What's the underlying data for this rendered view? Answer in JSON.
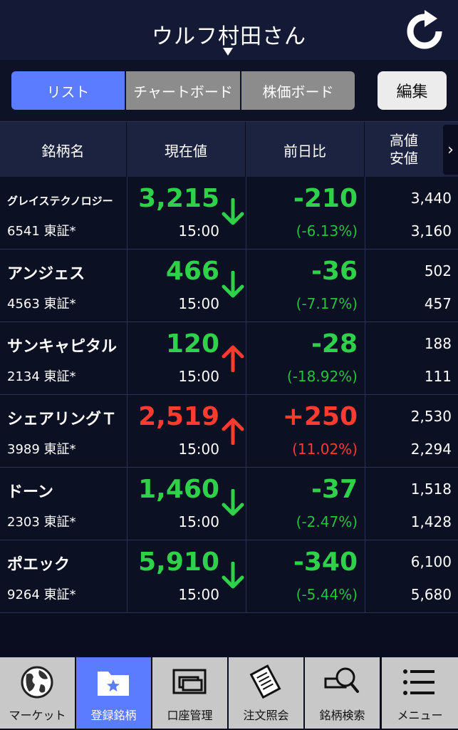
{
  "header": {
    "title": "ウルフ村田さん"
  },
  "segments": [
    {
      "label": "リスト",
      "active": true
    },
    {
      "label": "チャートボード",
      "active": false
    },
    {
      "label": "株価ボード",
      "active": false
    }
  ],
  "edit_label": "編集",
  "columns": {
    "name": "銘柄名",
    "price": "現在値",
    "change": "前日比",
    "high": "高値",
    "low": "安値",
    "more": "›"
  },
  "rows": [
    {
      "name": "グレイステクノロジー",
      "code": "6541 東証*",
      "price": "3,215",
      "time": "15:00",
      "direction": "down",
      "change": "-210",
      "pct": "(-6.13%)",
      "high": "3,440",
      "low": "3,160",
      "color": "green"
    },
    {
      "name": "アンジェス",
      "code": "4563 東証*",
      "price": "466",
      "time": "15:00",
      "direction": "down",
      "change": "-36",
      "pct": "(-7.17%)",
      "high": "502",
      "low": "457",
      "color": "green"
    },
    {
      "name": "サンキャピタル",
      "code": "2134 東証*",
      "price": "120",
      "time": "15:00",
      "direction": "up",
      "change": "-28",
      "pct": "(-18.92%)",
      "high": "188",
      "low": "111",
      "color": "green"
    },
    {
      "name": "シェアリングＴ",
      "code": "3989 東証*",
      "price": "2,519",
      "time": "15:00",
      "direction": "up",
      "change": "+250",
      "pct": "(11.02%)",
      "high": "2,530",
      "low": "2,294",
      "color": "red"
    },
    {
      "name": "ドーン",
      "code": "2303 東証*",
      "price": "1,460",
      "time": "15:00",
      "direction": "down",
      "change": "-37",
      "pct": "(-2.47%)",
      "high": "1,518",
      "low": "1,428",
      "color": "green"
    },
    {
      "name": "ポエック",
      "code": "9264 東証*",
      "price": "5,910",
      "time": "15:00",
      "direction": "down",
      "change": "-340",
      "pct": "(-5.44%)",
      "high": "6,100",
      "low": "5,680",
      "color": "green"
    }
  ],
  "tabs": [
    {
      "label": "マーケット",
      "icon": "globe-icon",
      "active": false
    },
    {
      "label": "登録銘柄",
      "icon": "folder-star-icon",
      "active": true
    },
    {
      "label": "口座管理",
      "icon": "cards-icon",
      "active": false
    },
    {
      "label": "注文照会",
      "icon": "document-icon",
      "active": false
    },
    {
      "label": "銘柄検索",
      "icon": "magnifier-icon",
      "active": false
    },
    {
      "label": "メニュー",
      "icon": "hamburger-icon",
      "active": false
    }
  ],
  "colors": {
    "accent": "#5b7cff",
    "down_green": "#2fd14a",
    "up_red": "#ff3b30",
    "background": "#0a0d1f"
  }
}
